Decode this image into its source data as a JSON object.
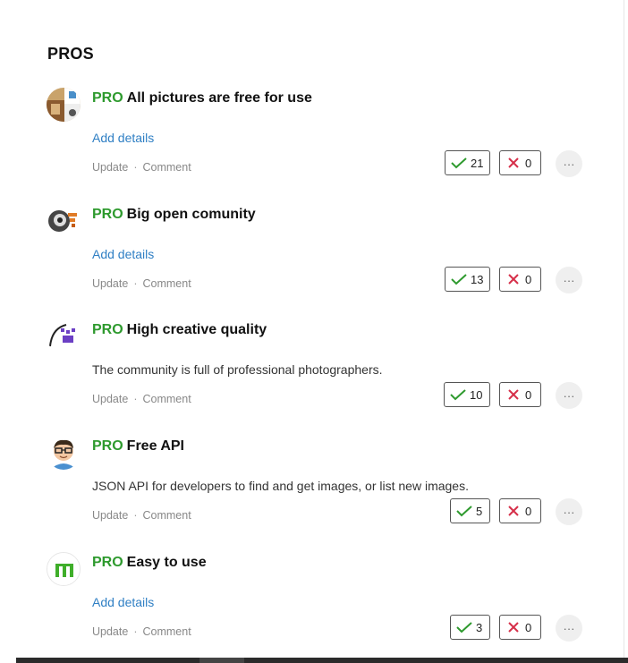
{
  "section": {
    "title": "PROS"
  },
  "items": [
    {
      "pro_tag": "PRO",
      "title": "All pictures are free for use",
      "details": "Add details",
      "update_label": "Update",
      "comment_label": "Comment",
      "separator": "·",
      "upvotes": "21",
      "downvotes": "0",
      "more_label": "···",
      "avatar_icon": "photo-collage-icon"
    },
    {
      "pro_tag": "PRO",
      "title": "Big open comunity",
      "details": "Add details",
      "update_label": "Update",
      "comment_label": "Comment",
      "separator": "·",
      "upvotes": "13",
      "downvotes": "0",
      "more_label": "···",
      "avatar_icon": "pixel-art-avatar-icon"
    },
    {
      "pro_tag": "PRO",
      "title": "High creative quality",
      "details": "The community is full of professional photographers.",
      "update_label": "Update",
      "comment_label": "Comment",
      "separator": "·",
      "upvotes": "10",
      "downvotes": "0",
      "more_label": "···",
      "avatar_icon": "purple-pixel-avatar-icon"
    },
    {
      "pro_tag": "PRO",
      "title": "Free API",
      "details": "JSON API for developers to find and get images, or list new images.",
      "update_label": "Update",
      "comment_label": "Comment",
      "separator": "·",
      "upvotes": "5",
      "downvotes": "0",
      "more_label": "···",
      "avatar_icon": "cartoon-person-avatar-icon"
    },
    {
      "pro_tag": "PRO",
      "title": "Easy to use",
      "details": "Add details",
      "update_label": "Update",
      "comment_label": "Comment",
      "separator": "·",
      "upvotes": "3",
      "downvotes": "0",
      "more_label": "···",
      "avatar_icon": "green-logo-avatar-icon"
    }
  ],
  "colors": {
    "pro_green": "#2e9a2e",
    "link_blue": "#2f7fc4",
    "check_green": "#2e9a2e",
    "cross_red": "#d6304a"
  }
}
